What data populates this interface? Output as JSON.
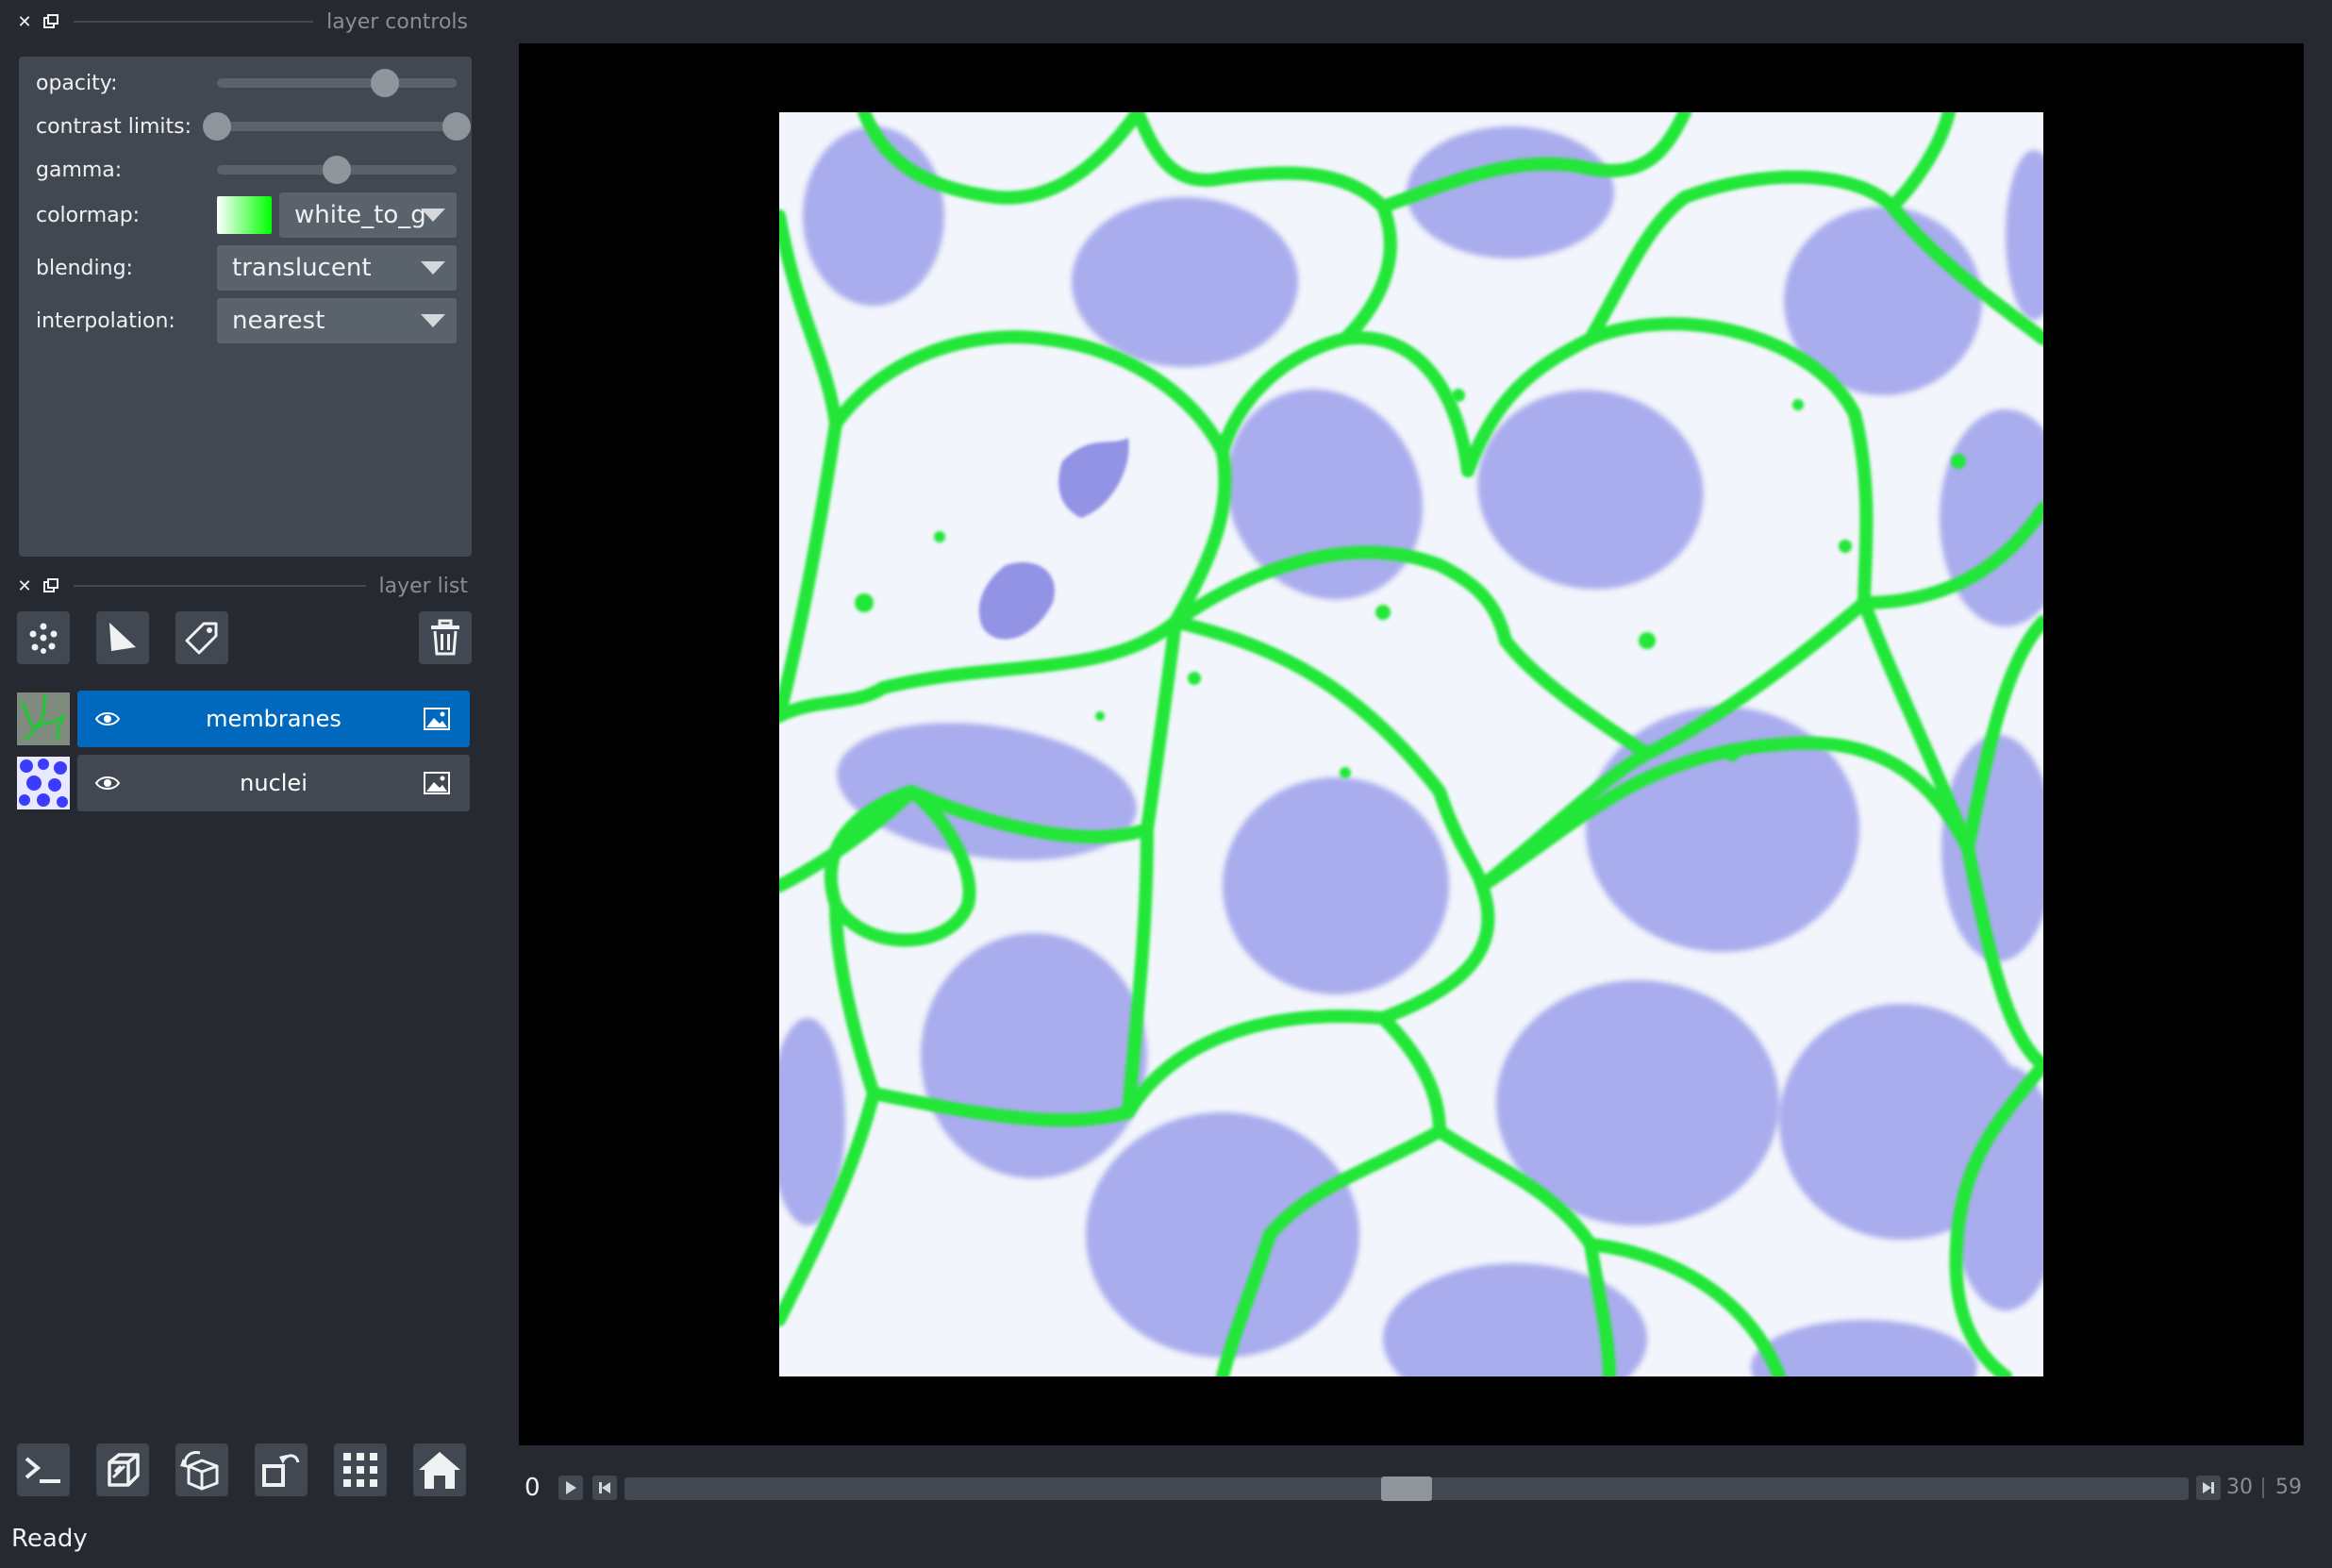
{
  "layer_controls": {
    "title": "layer controls",
    "opacity": {
      "label": "opacity:",
      "value": 0.7
    },
    "contrast_limits": {
      "label": "contrast limits:",
      "low": 0.0,
      "high": 1.0
    },
    "gamma": {
      "label": "gamma:",
      "value": 0.5
    },
    "colormap": {
      "label": "colormap:",
      "value": "white_to_g",
      "swatch_from": "#ffffff",
      "swatch_to": "#00ff00"
    },
    "blending": {
      "label": "blending:",
      "value": "translucent"
    },
    "interpolation": {
      "label": "interpolation:",
      "value": "nearest"
    }
  },
  "layer_list": {
    "title": "layer list",
    "tools": [
      "points-icon",
      "shapes-icon",
      "labels-icon",
      "delete-icon"
    ],
    "layers": [
      {
        "name": "membranes",
        "selected": true,
        "visible": true,
        "color": "#00c800"
      },
      {
        "name": "nuclei",
        "selected": false,
        "visible": true,
        "color": "#3c3cff"
      }
    ]
  },
  "bottom_buttons": [
    "console-icon",
    "ndisplay-icon",
    "roll-icon",
    "transpose-icon",
    "grid-icon",
    "home-icon"
  ],
  "dims": {
    "current": "0",
    "position": 30,
    "max": 59,
    "fraction": 0.5
  },
  "status": {
    "text": "Ready"
  },
  "colors": {
    "accent": "#0069bd",
    "background": "#262930",
    "foreground": "#414851",
    "membrane": "#22e639",
    "nucleus": "#9a9bea"
  }
}
